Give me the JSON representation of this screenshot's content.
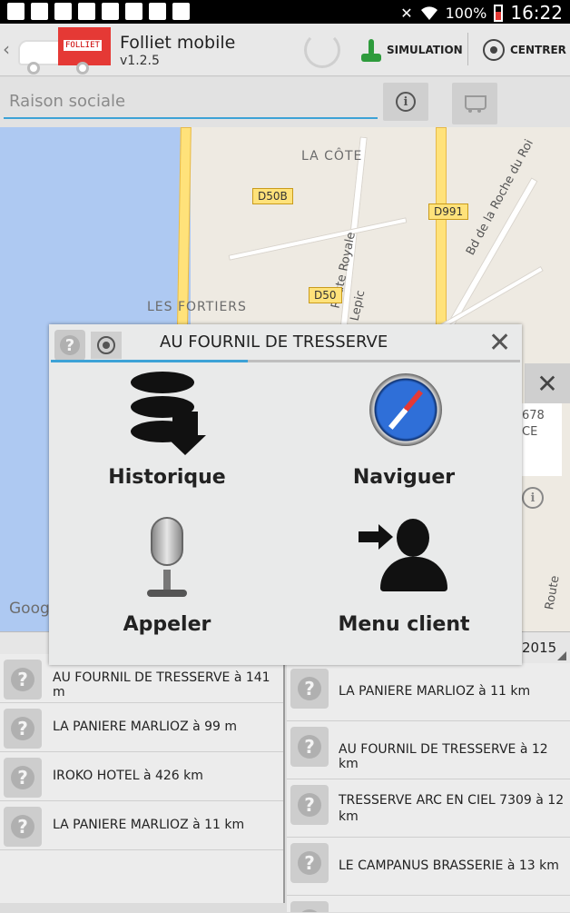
{
  "status_bar": {
    "battery": "100%",
    "time": "16:22"
  },
  "app": {
    "title": "Folliet mobile",
    "version": "v1.2.5",
    "logo_text": "FOLLIET"
  },
  "actions": {
    "simulation": "SIMULATION",
    "centrer": "CENTRER"
  },
  "search": {
    "placeholder": "Raison sociale",
    "value": ""
  },
  "map": {
    "labels": {
      "la_cote": "LA CÔTE",
      "les_fortiers": "LES FORTIERS",
      "route_royale": "Route Royale",
      "bd_roche": "Bd de la Roche du Roi",
      "lepic": "d Lepic",
      "route": "Route"
    },
    "shields": {
      "d50b": "D50B",
      "d991": "D991",
      "d50": "D50"
    },
    "attribution": "Goog"
  },
  "popup": {
    "title": "AU FOURNIL DE TRESSERVE",
    "progress": 0.42,
    "tiles": {
      "historique": "Historique",
      "naviguer": "Naviguer",
      "appeler": "Appeler",
      "menu_client": "Menu client"
    }
  },
  "side_panel": {
    "line1": "678",
    "line2": "CE"
  },
  "list_header": {
    "year": "2015"
  },
  "left_list": [
    "AU FOURNIL DE TRESSERVE à 141 m",
    "LA PANIERE MARLIOZ à 99 m",
    "IROKO HOTEL à 426 km",
    "LA PANIERE MARLIOZ à 11 km"
  ],
  "right_list": [
    "LA PANIERE MARLIOZ à 11 km",
    "AU FOURNIL DE TRESSERVE à 12 km",
    "TRESSERVE ARC EN CIEL 7309 à 12 km",
    "LE CAMPANUS BRASSERIE à 13 km"
  ],
  "colors": {
    "accent": "#3da2d6",
    "brand": "#e53935",
    "sim_green": "#2e9b3c"
  },
  "icons": {
    "marker": "help-marker-icon",
    "historique": "database-download-icon",
    "naviguer": "compass-icon",
    "appeler": "microphone-icon",
    "menu_client": "user-arrow-icon"
  }
}
